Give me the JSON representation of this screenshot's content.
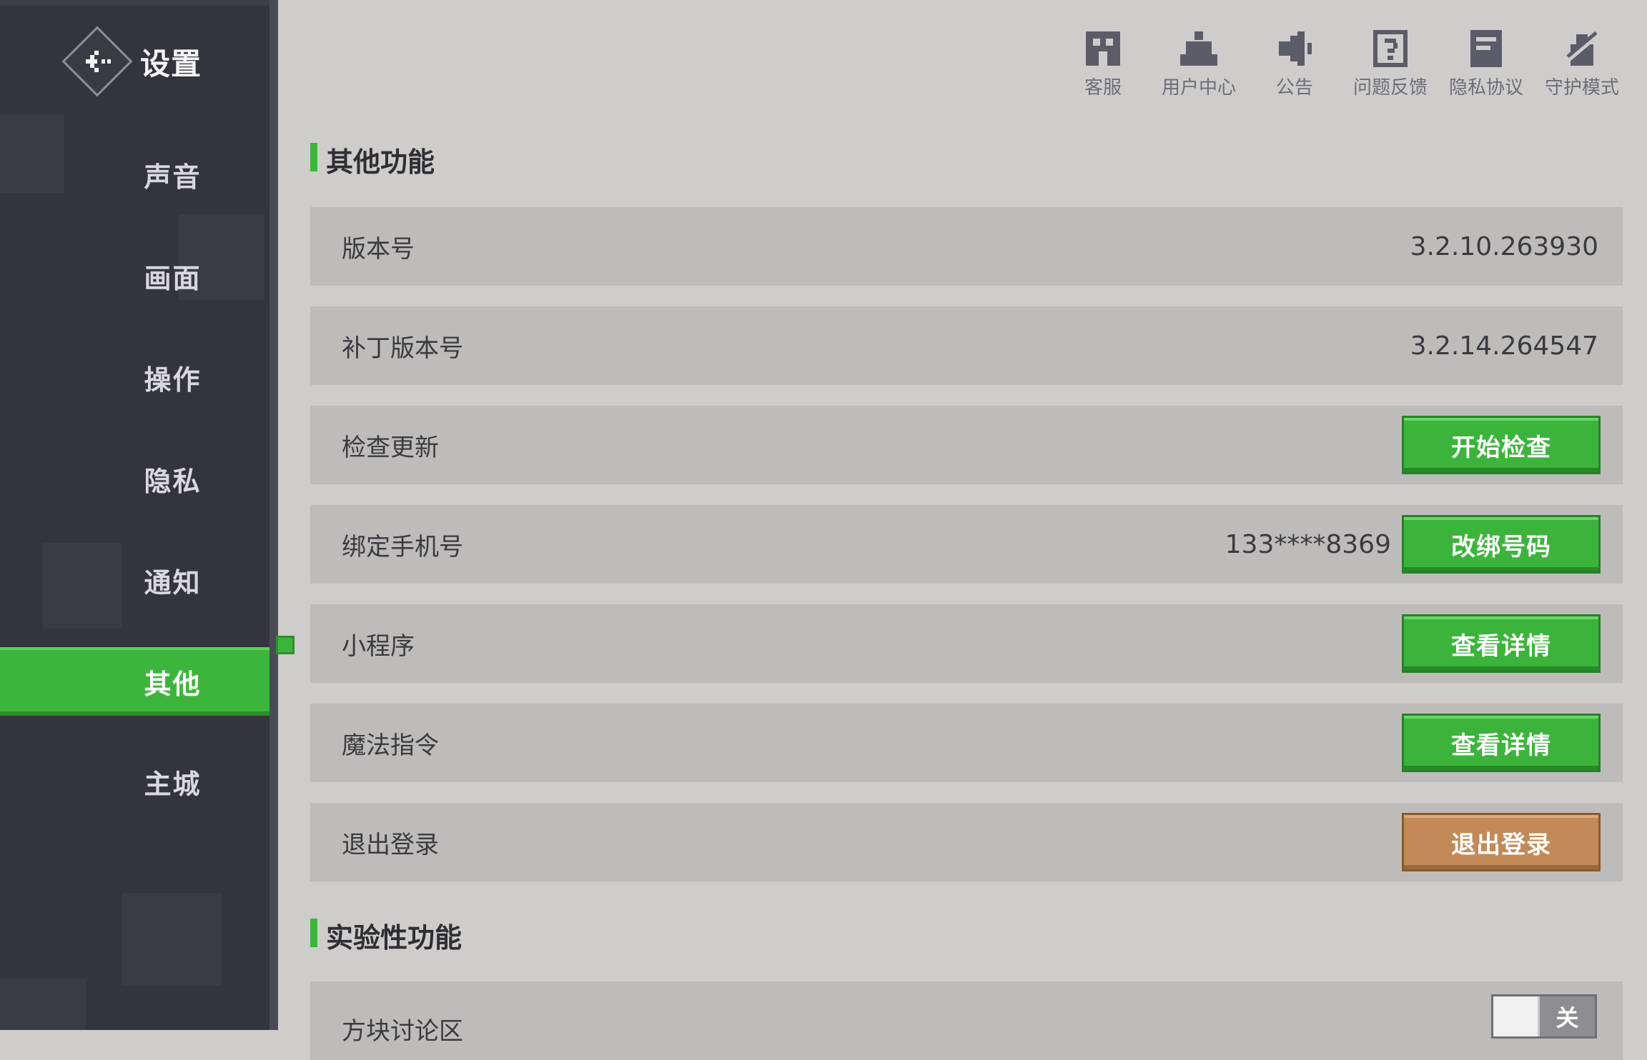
{
  "sidebar": {
    "title": "设置",
    "items": [
      {
        "label": "声音"
      },
      {
        "label": "画面"
      },
      {
        "label": "操作"
      },
      {
        "label": "隐私"
      },
      {
        "label": "通知"
      },
      {
        "label": "其他"
      },
      {
        "label": "主城"
      }
    ],
    "active_item": "其他"
  },
  "topbar": {
    "items": [
      {
        "label": "客服",
        "icon": "customer-service-icon"
      },
      {
        "label": "用户中心",
        "icon": "user-center-icon"
      },
      {
        "label": "公告",
        "icon": "announcement-icon"
      },
      {
        "label": "问题反馈",
        "icon": "feedback-icon"
      },
      {
        "label": "隐私协议",
        "icon": "privacy-agreement-icon"
      },
      {
        "label": "守护模式",
        "icon": "guardian-mode-icon"
      }
    ]
  },
  "sections": {
    "other": {
      "title": "其他功能",
      "rows": {
        "version": {
          "label": "版本号",
          "value": "3.2.10.263930"
        },
        "patch_version": {
          "label": "补丁版本号",
          "value": "3.2.14.264547"
        },
        "check_update": {
          "label": "检查更新",
          "button": "开始检查"
        },
        "bind_phone": {
          "label": "绑定手机号",
          "value": "133****8369",
          "button": "改绑号码"
        },
        "mini_program": {
          "label": "小程序",
          "button": "查看详情"
        },
        "magic_command": {
          "label": "魔法指令",
          "button": "查看详情"
        },
        "logout": {
          "label": "退出登录",
          "button": "退出登录"
        }
      }
    },
    "experimental": {
      "title": "实验性功能",
      "rows": {
        "block_forum": {
          "label": "方块讨论区",
          "toggle": "关"
        }
      }
    }
  },
  "colors": {
    "accent": "#3cb53c",
    "danger_button": "#c38a58",
    "sidebar_bg": "#34343d"
  }
}
